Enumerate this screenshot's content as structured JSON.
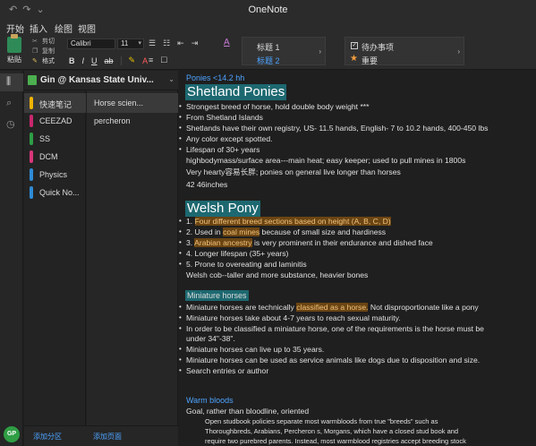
{
  "window": {
    "title": "OneNote"
  },
  "menu": {
    "tabs": [
      "开始",
      "插入",
      "绘图",
      "视图"
    ]
  },
  "ribbon": {
    "paste_label": "粘贴",
    "cut": "剪切",
    "copy": "复制",
    "format": "格式",
    "font_name": "Calibri",
    "font_size": "11",
    "bold": "B",
    "italic": "I",
    "underline": "U",
    "strike": "ab",
    "styles": {
      "heading1": "标题 1",
      "heading2": "标题 2"
    },
    "tags": {
      "todo": "待办事项",
      "important": "重要"
    }
  },
  "notebook": {
    "name": "Gin @ Kansas State Univ..."
  },
  "sections": [
    {
      "name": "快速笔记",
      "color": "#f0b400"
    },
    {
      "name": "CEEZAD",
      "color": "#c8286e"
    },
    {
      "name": "SS",
      "color": "#2e9e44"
    },
    {
      "name": "DCM",
      "color": "#d9367a"
    },
    {
      "name": "Physics",
      "color": "#2e8bd6"
    },
    {
      "name": "Quick No...",
      "color": "#2e8bd6"
    }
  ],
  "pages": [
    "Horse scien...",
    "percheron"
  ],
  "footer": {
    "add_section": "添加分区",
    "add_page": "添加页面",
    "avatar": "GP"
  },
  "content": {
    "intro": "Ponies <14.2 hh",
    "shetland": {
      "title": "Shetland Ponies",
      "bullets": [
        "Strongest breed of horse, hold double body weight ***",
        "From Shetland Islands",
        "Shetlands have their own registry, US- 11.5 hands, English- 7 to 10.2 hands, 400-450 lbs",
        "Any color except spotted.",
        "Lifespan of 30+ years"
      ],
      "lines": [
        "highbodymass/surface area---main heat; easy keeper; used to pull mines in 1800s",
        "Very hearty容易长胖; ponies on general live longer than horses",
        "42 46inches"
      ]
    },
    "welsh": {
      "title": "Welsh Pony",
      "b1_pre": "1. ",
      "b1_hl": "Four different breed sections based on height (A, B, C, D)",
      "b2_pre": "2. Used in ",
      "b2_hl": "coal mines",
      "b2_post": " because of small size and hardiness",
      "b3_pre": "3. ",
      "b3_hl": "Arabian ancestry",
      "b3_post": " is very prominent in their endurance and dished face",
      "b4": "4. Longer lifespan (35+ years)",
      "b5": "5. Prone to overeating and laminitis",
      "line": "Welsh cob--taller and more substance, heavier bones"
    },
    "mini": {
      "title": "Miniature horses",
      "b1_pre": "Miniature horses are technically ",
      "b1_hl": "classified as a horse.",
      "b1_post": "  Not disproportionate like a pony",
      "b2": "Miniature horses take about 4-7 years to reach sexual maturity.",
      "b3a": "In order to be classified a miniature horse, one of the requirements is the horse must be",
      "b3b": "under 34\"-38\".",
      "b4": "Miniature horses can live up to 35 years.",
      "b5": "Miniature horses can be used as service animals like dogs due to disposition and size.",
      "b6": "Search entries or author"
    },
    "warm": {
      "title": "Warm bloods",
      "line": "Goal, rather than bloodline, oriented",
      "p1": "Open studbook policies separate most warmbloods from true \"breeds\" such as",
      "p2": "Thoroughbreds, Arabians, Percheron s, Morgans, which have a closed stud book and",
      "p3": "require two purebred parents. Instead, most warmblood registries accept breeding stock"
    }
  }
}
